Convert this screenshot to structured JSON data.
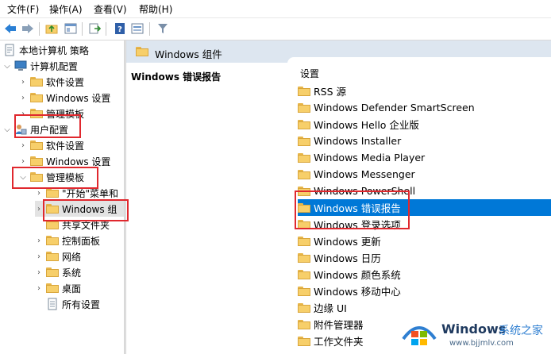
{
  "menubar": {
    "items": [
      "文件(F)",
      "操作(A)",
      "查看(V)",
      "帮助(H)"
    ]
  },
  "tree": {
    "root": "本地计算机 策略",
    "computer_config": "计算机配置",
    "computer_children": [
      "软件设置",
      "Windows 设置",
      "管理模板"
    ],
    "user_config": "用户配置",
    "user_children": [
      "软件设置",
      "Windows 设置",
      "管理模板"
    ],
    "admin_templates_children": [
      "\"开始\"菜单和",
      "Windows 组",
      "共享文件夹",
      "控制面板",
      "网络",
      "系统",
      "桌面",
      "所有设置"
    ]
  },
  "main": {
    "header_title": "Windows 组件",
    "description_title": "Windows 错误报告",
    "list_header": "设置",
    "items": [
      "RSS 源",
      "Windows Defender SmartScreen",
      "Windows Hello 企业版",
      "Windows Installer",
      "Windows Media Player",
      "Windows Messenger",
      "Windows PowerShell",
      "Windows 错误报告",
      "Windows 登录选项",
      "Windows 更新",
      "Windows 日历",
      "Windows 颜色系统",
      "Windows 移动中心",
      "边缘 UI",
      "附件管理器",
      "工作文件夹"
    ],
    "selected_index": 7
  },
  "watermark": {
    "brand": "Windows",
    "site_name": "系统之家",
    "url": "www.bjjmlv.com"
  },
  "colors": {
    "selection": "#0078d7",
    "highlight_box": "#e0282e",
    "header_band": "#dde6f0"
  }
}
